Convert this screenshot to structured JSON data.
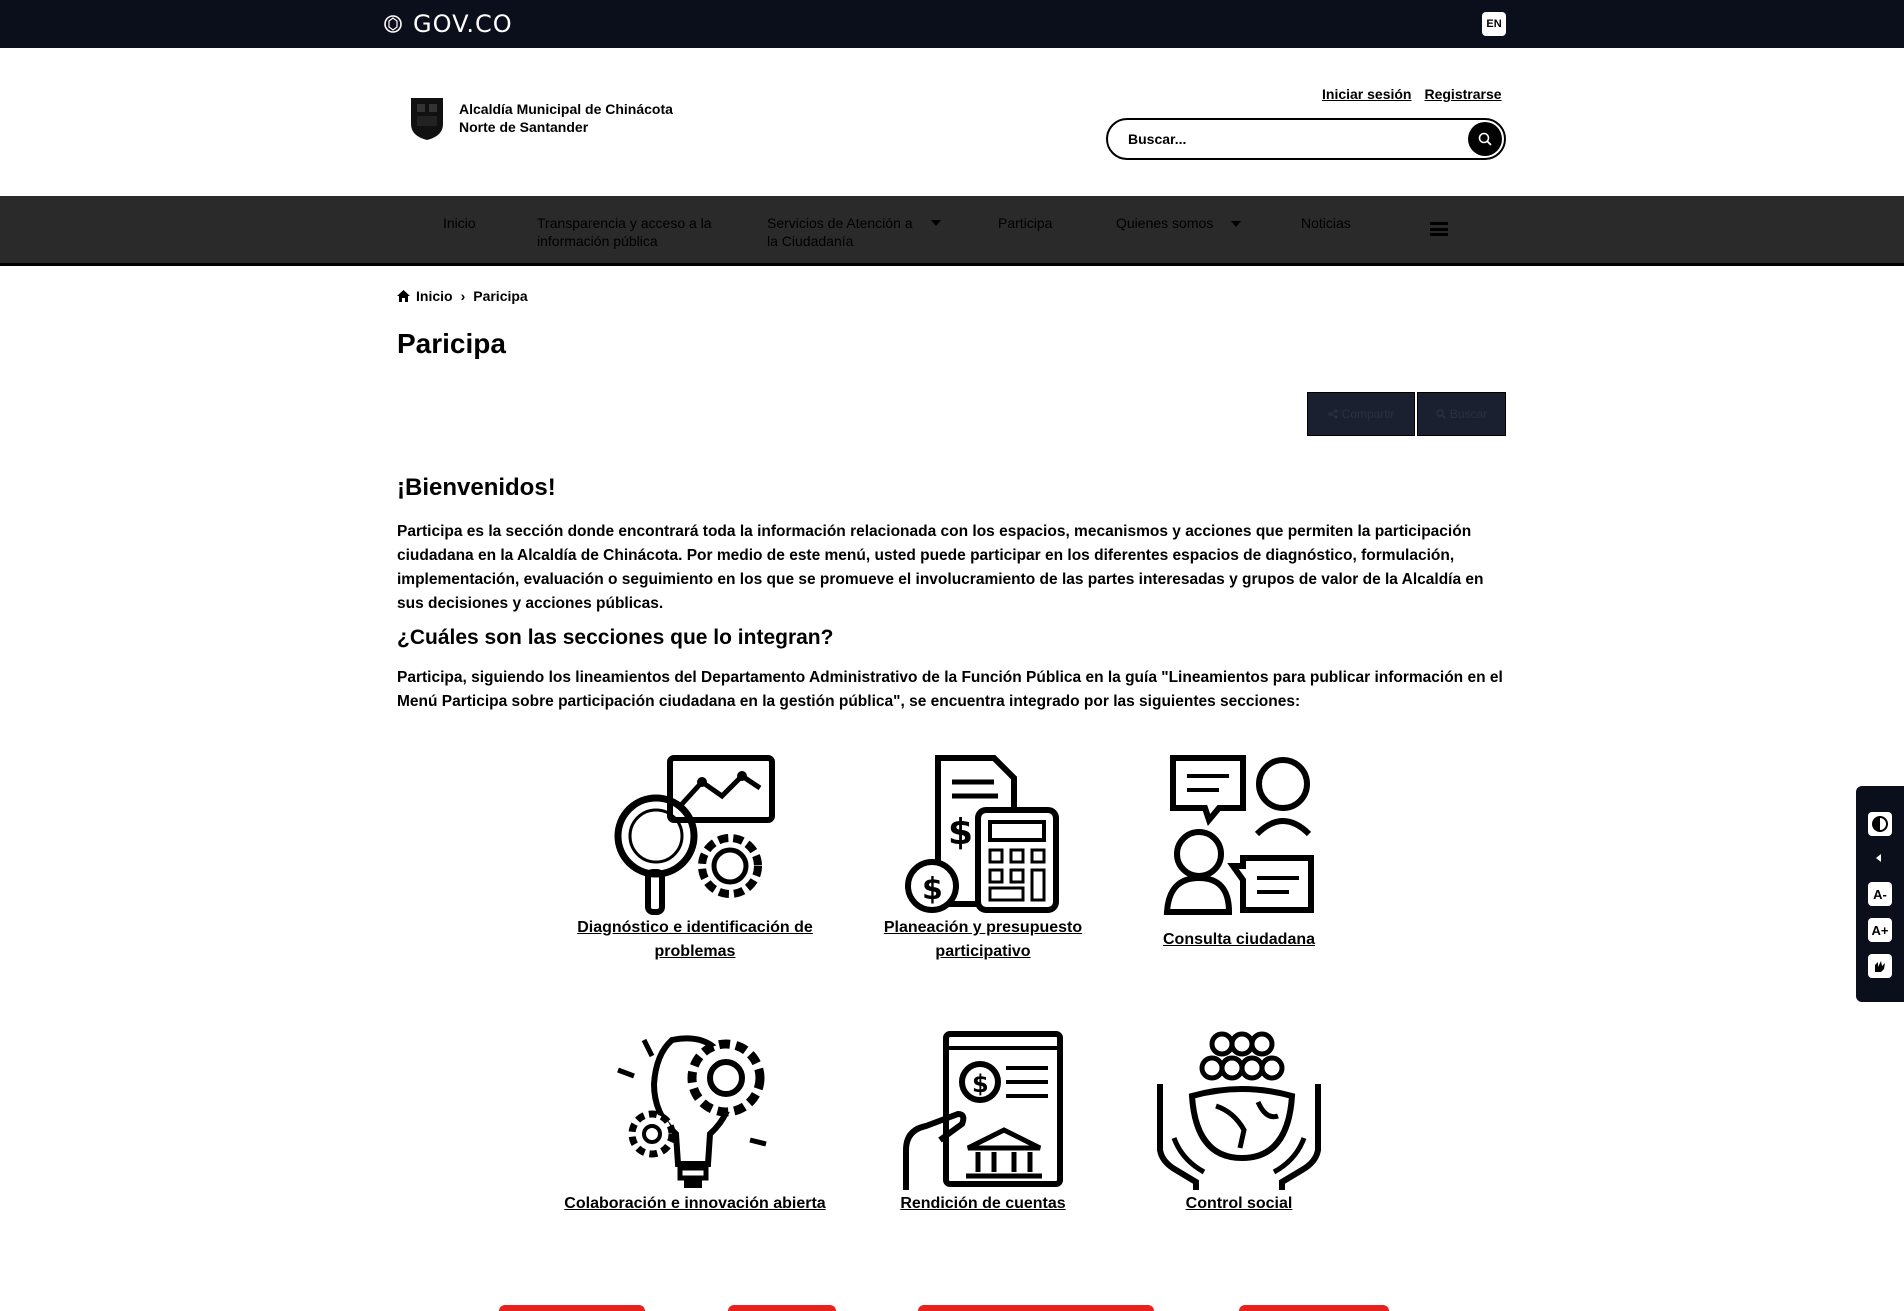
{
  "govbar": {
    "logo_text": "GOV.CO",
    "lang_label": "EN"
  },
  "header": {
    "entity_name": "Alcaldía Municipal de Chinácota",
    "entity_region": "Norte de Santander",
    "login_label": "Iniciar sesión",
    "register_label": "Registrarse",
    "search_placeholder": "Buscar..."
  },
  "nav": {
    "items": [
      {
        "label": "Inicio"
      },
      {
        "label": "Transparencia y acceso a la información pública"
      },
      {
        "label": "Servicios de Atención a la Ciudadanía"
      },
      {
        "label": "Participa"
      },
      {
        "label": "Quienes somos"
      },
      {
        "label": "Noticias"
      }
    ]
  },
  "breadcrumb": {
    "home": "Inicio",
    "current": "Paricipa"
  },
  "page": {
    "title": "Paricipa",
    "share_label": "Compartir",
    "search_label": "Buscar",
    "welcome": "¡Bienvenidos!",
    "intro": "Participa es la sección donde encontrará toda la información relacionada con los espacios, mecanismos y acciones que permiten la participación ciudadana en la Alcaldía de Chinácota. Por medio de este menú, usted puede participar en los diferentes espacios de diagnóstico, formulación, implementación, evaluación o seguimiento en los que se promueve el involucramiento de las partes interesadas y grupos de valor de la Alcaldía en sus decisiones y acciones públicas.",
    "sections_heading": "¿Cuáles son las secciones que lo integran?",
    "sections_text": "Participa, siguiendo los lineamientos del Departamento Administrativo de la Función Pública en la guía \"Lineamientos para publicar información en el Menú Participa sobre participación ciudadana en la gestión pública\", se encuentra integrado por las siguientes secciones:"
  },
  "sections": [
    {
      "label": "Diagnóstico e identificación de problemas",
      "icon": "analytics-magnifier-gear-icon"
    },
    {
      "label": "Planeación y presupuesto participativo",
      "icon": "calculator-budget-icon"
    },
    {
      "label": "Consulta ciudadana",
      "icon": "people-chat-icon"
    },
    {
      "label": "Colaboración e innovación abierta",
      "icon": "lightbulb-gears-icon"
    },
    {
      "label": "Rendición de cuentas",
      "icon": "accountability-document-icon"
    },
    {
      "label": "Control social",
      "icon": "hands-globe-people-icon"
    }
  ],
  "accessibility": {
    "contrast_icon": "contrast-icon",
    "decrease_text": "A-",
    "increase_text": "A+",
    "sign_language_icon": "sign-language-icon"
  },
  "colors": {
    "govbar": "#0b0f1c",
    "nav": "#2a2a2a",
    "accent_red": "#e8201e"
  }
}
